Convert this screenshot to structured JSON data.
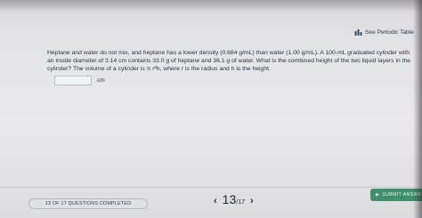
{
  "header": {
    "periodic_table_label": "See Periodic Table",
    "periodic_table_icon": "bar-chart-icon"
  },
  "question": {
    "text": "Heptane and water do not mix, and heptane has a lower density (0.684 g/mL) than water (1.00 g/mL). A 100-mL graduated cylinder with an inside diameter of 3.14 cm contains 33.0 g of heptane and 36.1 g of water. What is the combined height of the two liquid layers in the cylinder? The volume of a cylinder is π r²h, where r is the radius and h is the height.",
    "answer_value": "",
    "answer_unit": "cm"
  },
  "footer": {
    "progress_label": "13 OF 17 QUESTIONS COMPLETED",
    "prev_icon": "chevron-left-icon",
    "current_page": "13",
    "total_pages": "/17",
    "next_icon": "chevron-right-icon",
    "submit_label": "SUBMIT ANSWE"
  },
  "colors": {
    "submit_button": "#3f8f6b",
    "text": "#2c3440"
  }
}
